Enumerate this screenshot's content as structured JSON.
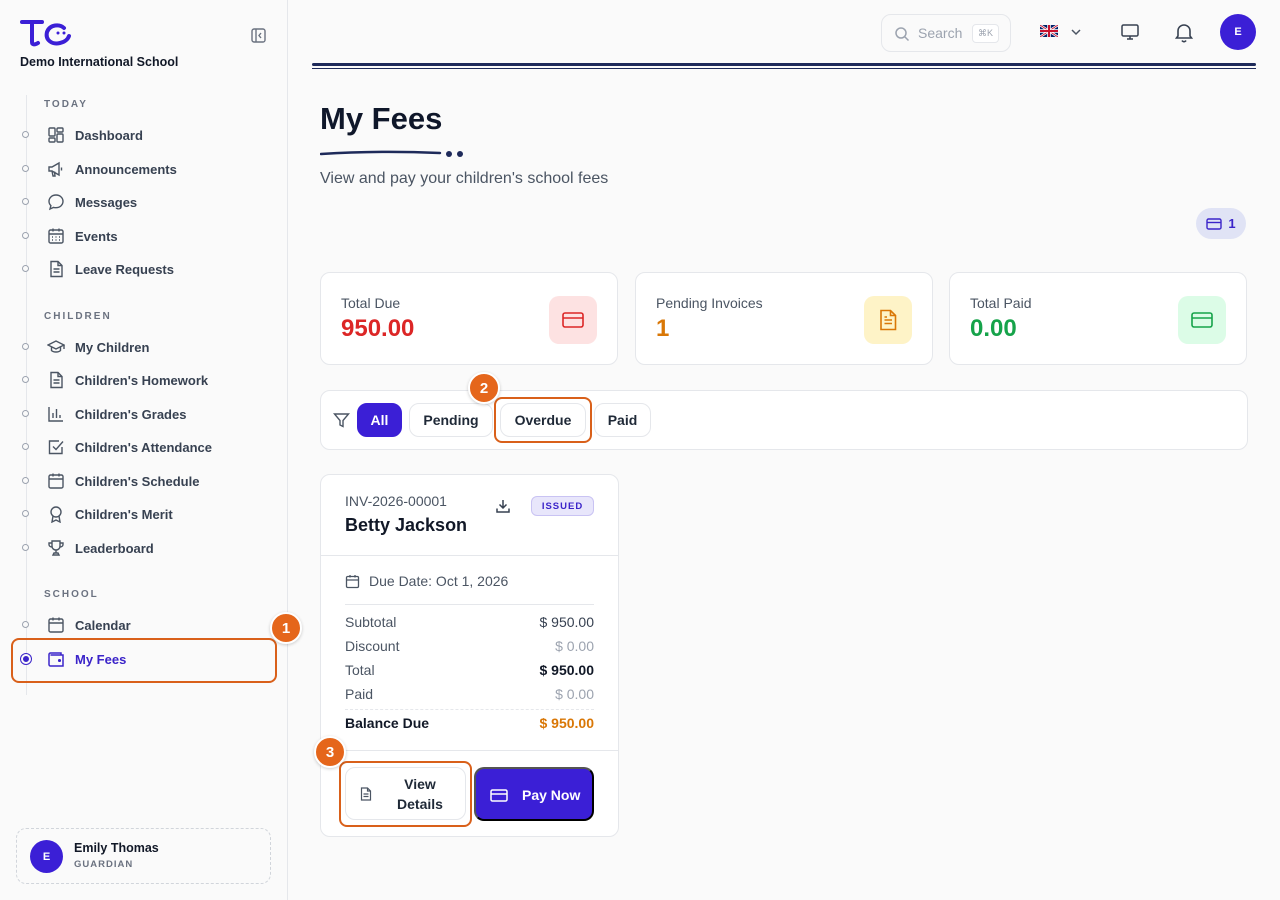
{
  "brand": {
    "school_name": "Demo International School"
  },
  "sidebar": {
    "sections": [
      {
        "label": "TODAY"
      },
      {
        "label": "CHILDREN"
      },
      {
        "label": "SCHOOL"
      }
    ],
    "items": [
      {
        "label": "Dashboard",
        "icon": "dashboard-icon"
      },
      {
        "label": "Announcements",
        "icon": "megaphone-icon"
      },
      {
        "label": "Messages",
        "icon": "message-icon"
      },
      {
        "label": "Events",
        "icon": "calendar-grid-icon"
      },
      {
        "label": "Leave Requests",
        "icon": "document-icon"
      },
      {
        "label": "My Children",
        "icon": "graduation-cap-icon"
      },
      {
        "label": "Children's Homework",
        "icon": "document-icon"
      },
      {
        "label": "Children's Grades",
        "icon": "bar-chart-icon"
      },
      {
        "label": "Children's Attendance",
        "icon": "checkbox-icon"
      },
      {
        "label": "Children's Schedule",
        "icon": "calendar-icon"
      },
      {
        "label": "Children's Merit",
        "icon": "award-icon"
      },
      {
        "label": "Leaderboard",
        "icon": "trophy-icon"
      },
      {
        "label": "Calendar",
        "icon": "calendar-icon"
      },
      {
        "label": "My Fees",
        "icon": "wallet-icon",
        "active": true
      }
    ]
  },
  "user": {
    "initial": "E",
    "name": "Emily Thomas",
    "role": "GUARDIAN"
  },
  "topbar": {
    "search_placeholder": "Search",
    "shortcut": "⌘K",
    "avatar_initial": "E"
  },
  "page": {
    "title": "My Fees",
    "subtitle": "View and pay your children's school fees",
    "count": "1"
  },
  "stats": [
    {
      "label": "Total Due",
      "value": "950.00",
      "color": "#dc2626",
      "icon": "credit-card-icon",
      "icon_bg": "#fde2e2"
    },
    {
      "label": "Pending Invoices",
      "value": "1",
      "color": "#d97706",
      "icon": "file-text-icon",
      "icon_bg": "#fef3c7"
    },
    {
      "label": "Total Paid",
      "value": "0.00",
      "color": "#16a34a",
      "icon": "credit-card-icon",
      "icon_bg": "#dcfce7"
    }
  ],
  "filters": [
    {
      "label": "All",
      "active": true
    },
    {
      "label": "Pending"
    },
    {
      "label": "Overdue"
    },
    {
      "label": "Paid"
    }
  ],
  "invoice": {
    "number": "INV-2026-00001",
    "student": "Betty Jackson",
    "status": "ISSUED",
    "due_date": "Due Date: Oct 1, 2026",
    "rows": [
      {
        "label": "Subtotal",
        "value": "$ 950.00"
      },
      {
        "label": "Discount",
        "value": "$ 0.00"
      },
      {
        "label": "Total",
        "value": "$ 950.00"
      },
      {
        "label": "Paid",
        "value": "$ 0.00"
      }
    ],
    "balance_label": "Balance Due",
    "balance_value": "$ 950.00",
    "view_label": "View Details",
    "pay_label": "Pay Now"
  },
  "annotations": [
    "1",
    "2",
    "3"
  ],
  "colors": {
    "accent": "#3b1fd6",
    "annotation": "#e5661b"
  }
}
